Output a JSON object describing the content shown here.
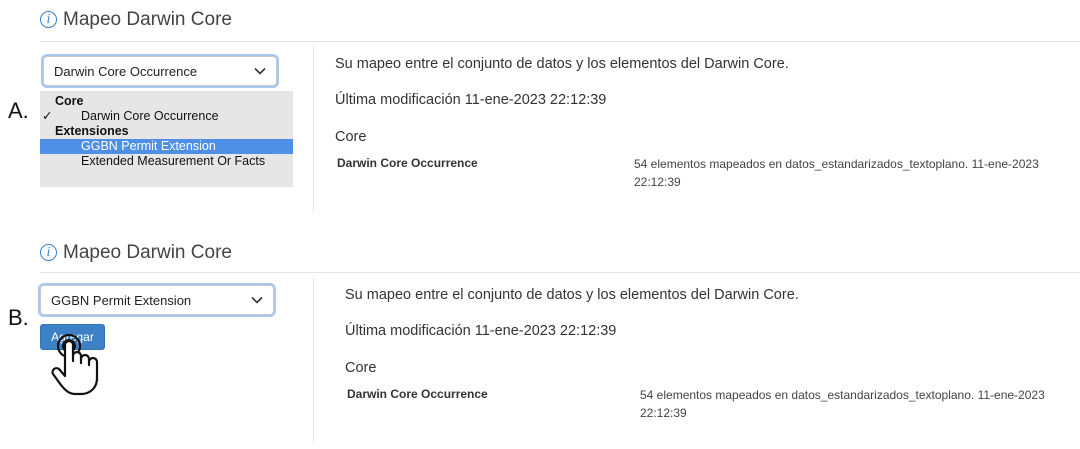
{
  "panel_a": {
    "marker": "A.",
    "title": "Mapeo Darwin Core",
    "select_value": "Darwin Core Occurrence",
    "dropdown": {
      "group_core": "Core",
      "core_item": "Darwin Core Occurrence",
      "check": "✓",
      "group_ext": "Extensiones",
      "ext_items": [
        "GGBN Permit Extension",
        "Extended Measurement Or Facts"
      ]
    },
    "description": "Su mapeo entre el conjunto de datos y los elementos del Darwin Core.",
    "last_modified": "Última modificación 11-ene-2023 22:12:39",
    "section": "Core",
    "core_name": "Darwin Core Occurrence",
    "core_detail": "54 elementos mapeados en datos_estandarizados_textoplano. 11-ene-2023 22:12:39"
  },
  "panel_b": {
    "marker": "B.",
    "title": "Mapeo Darwin Core",
    "select_value": "GGBN Permit Extension",
    "add_button": "Agregar",
    "description": "Su mapeo entre el conjunto de datos y los elementos del Darwin Core.",
    "last_modified": "Última modificación 11-ene-2023 22:12:39",
    "section": "Core",
    "core_name": "Darwin Core Occurrence",
    "core_detail": "54 elementos mapeados en datos_estandarizados_textoplano. 11-ene-2023 22:12:39"
  },
  "icons": {
    "info": "info-icon",
    "chevron": "chevron-down-icon",
    "cursor": "hand-pointer-icon"
  },
  "colors": {
    "accent": "#3c80c6",
    "highlight": "#4f8fe6",
    "focus_ring": "#a8c8ef",
    "dropdown_bg": "#e6e6e6"
  }
}
